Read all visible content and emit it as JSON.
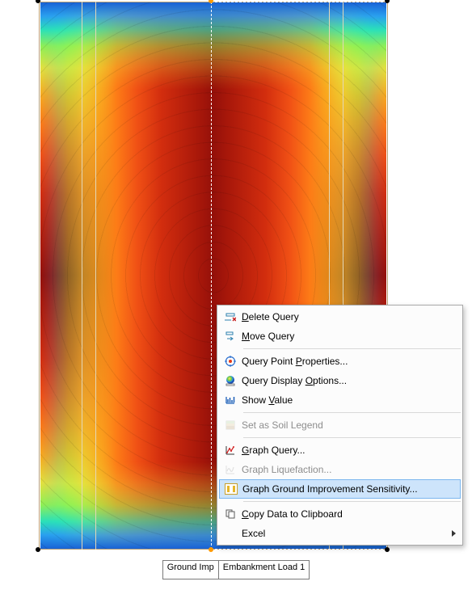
{
  "tags": {
    "left_clipped": "Ground Imp",
    "right": "Embankment Load 1"
  },
  "context_menu": {
    "delete_query": "Delete Query",
    "move_query": "Move Query",
    "query_point_properties": "Query Point Properties...",
    "query_display_options": "Query Display Options...",
    "show_value": "Show Value",
    "set_as_soil_legend": "Set as Soil Legend",
    "graph_query": "Graph Query...",
    "graph_liquefaction": "Graph Liquefaction...",
    "graph_ground_improvement_sensitivity": "Graph Ground Improvement Sensitivity...",
    "copy_data_to_clipboard": "Copy Data to Clipboard",
    "excel": "Excel"
  },
  "chart_data": {
    "type": "heatmap",
    "title": "",
    "xlabel": "",
    "ylabel": "",
    "legend": "rainbow (blue=low, dark-red=high)",
    "x_range": [
      0,
      1
    ],
    "y_range": [
      0,
      1
    ],
    "note": "No axes or numeric labels visible; values unknown — radial/rectangular heat distribution with cold rim and hot core.",
    "series": []
  },
  "colors": {
    "guide_border": "#b9a074",
    "menu_highlight_bg": "#cde4fb",
    "menu_highlight_border": "#7cb7ef"
  }
}
